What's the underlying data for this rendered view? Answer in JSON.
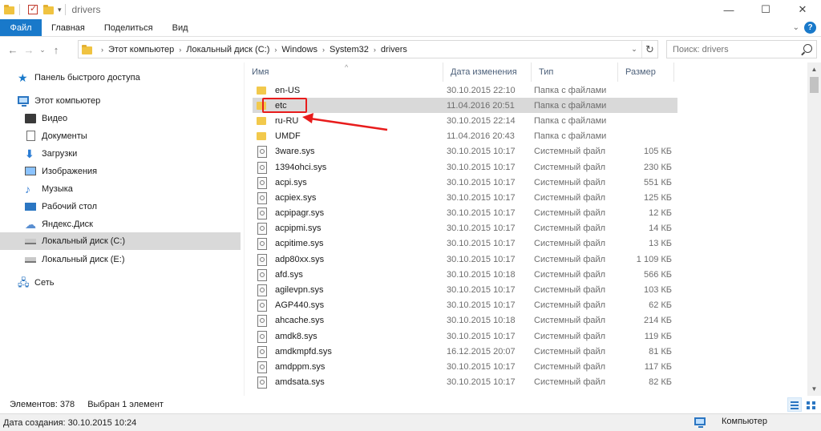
{
  "window": {
    "title": "drivers",
    "controls": {
      "minimize": "—",
      "maximize": "☐",
      "close": "✕"
    }
  },
  "ribbon": {
    "tabs": [
      "Файл",
      "Главная",
      "Поделиться",
      "Вид"
    ],
    "help": "?"
  },
  "address": {
    "crumbs": [
      "Этот компьютер",
      "Локальный диск (C:)",
      "Windows",
      "System32",
      "drivers"
    ],
    "search_placeholder": "Поиск: drivers"
  },
  "nav_pane": {
    "items": [
      {
        "label": "Панель быстрого доступа",
        "icon": "star-icon"
      },
      {
        "label": "Этот компьютер",
        "icon": "computer-icon"
      },
      {
        "label": "Видео",
        "icon": "video-icon"
      },
      {
        "label": "Документы",
        "icon": "documents-icon"
      },
      {
        "label": "Загрузки",
        "icon": "downloads-icon"
      },
      {
        "label": "Изображения",
        "icon": "pictures-icon"
      },
      {
        "label": "Музыка",
        "icon": "music-icon"
      },
      {
        "label": "Рабочий стол",
        "icon": "desktop-icon"
      },
      {
        "label": "Яндекс.Диск",
        "icon": "cloud-icon"
      },
      {
        "label": "Локальный диск (C:)",
        "icon": "drive-icon",
        "selected": true
      },
      {
        "label": "Локальный диск (E:)",
        "icon": "drive-icon"
      },
      {
        "label": "Сеть",
        "icon": "network-icon"
      }
    ]
  },
  "columns": {
    "name": "Имя",
    "date": "Дата изменения",
    "type": "Тип",
    "size": "Размер"
  },
  "files": [
    {
      "name": "en-US",
      "date": "30.10.2015 22:10",
      "type": "Папка с файлами",
      "size": "",
      "kind": "folder"
    },
    {
      "name": "etc",
      "date": "11.04.2016 20:51",
      "type": "Папка с файлами",
      "size": "",
      "kind": "folder",
      "selected": true
    },
    {
      "name": "ru-RU",
      "date": "30.10.2015 22:14",
      "type": "Папка с файлами",
      "size": "",
      "kind": "folder"
    },
    {
      "name": "UMDF",
      "date": "11.04.2016 20:43",
      "type": "Папка с файлами",
      "size": "",
      "kind": "folder"
    },
    {
      "name": "3ware.sys",
      "date": "30.10.2015 10:17",
      "type": "Системный файл",
      "size": "105 КБ",
      "kind": "sys"
    },
    {
      "name": "1394ohci.sys",
      "date": "30.10.2015 10:17",
      "type": "Системный файл",
      "size": "230 КБ",
      "kind": "sys"
    },
    {
      "name": "acpi.sys",
      "date": "30.10.2015 10:17",
      "type": "Системный файл",
      "size": "551 КБ",
      "kind": "sys"
    },
    {
      "name": "acpiex.sys",
      "date": "30.10.2015 10:17",
      "type": "Системный файл",
      "size": "125 КБ",
      "kind": "sys"
    },
    {
      "name": "acpipagr.sys",
      "date": "30.10.2015 10:17",
      "type": "Системный файл",
      "size": "12 КБ",
      "kind": "sys"
    },
    {
      "name": "acpipmi.sys",
      "date": "30.10.2015 10:17",
      "type": "Системный файл",
      "size": "14 КБ",
      "kind": "sys"
    },
    {
      "name": "acpitime.sys",
      "date": "30.10.2015 10:17",
      "type": "Системный файл",
      "size": "13 КБ",
      "kind": "sys"
    },
    {
      "name": "adp80xx.sys",
      "date": "30.10.2015 10:17",
      "type": "Системный файл",
      "size": "1 109 КБ",
      "kind": "sys"
    },
    {
      "name": "afd.sys",
      "date": "30.10.2015 10:18",
      "type": "Системный файл",
      "size": "566 КБ",
      "kind": "sys"
    },
    {
      "name": "agilevpn.sys",
      "date": "30.10.2015 10:17",
      "type": "Системный файл",
      "size": "103 КБ",
      "kind": "sys"
    },
    {
      "name": "AGP440.sys",
      "date": "30.10.2015 10:17",
      "type": "Системный файл",
      "size": "62 КБ",
      "kind": "sys"
    },
    {
      "name": "ahcache.sys",
      "date": "30.10.2015 10:18",
      "type": "Системный файл",
      "size": "214 КБ",
      "kind": "sys"
    },
    {
      "name": "amdk8.sys",
      "date": "30.10.2015 10:17",
      "type": "Системный файл",
      "size": "119 КБ",
      "kind": "sys"
    },
    {
      "name": "amdkmpfd.sys",
      "date": "16.12.2015 20:07",
      "type": "Системный файл",
      "size": "81 КБ",
      "kind": "sys"
    },
    {
      "name": "amdppm.sys",
      "date": "30.10.2015 10:17",
      "type": "Системный файл",
      "size": "117 КБ",
      "kind": "sys"
    },
    {
      "name": "amdsata.sys",
      "date": "30.10.2015 10:17",
      "type": "Системный файл",
      "size": "82 КБ",
      "kind": "sys"
    }
  ],
  "status": {
    "count": "Элементов: 378",
    "selected": "Выбран 1 элемент"
  },
  "footer": {
    "created": "Дата создания: 30.10.2015 10:24",
    "location": "Компьютер"
  },
  "colors": {
    "accent": "#1979ca",
    "annotation": "#e81c1c",
    "selection": "#d9d9d9"
  }
}
